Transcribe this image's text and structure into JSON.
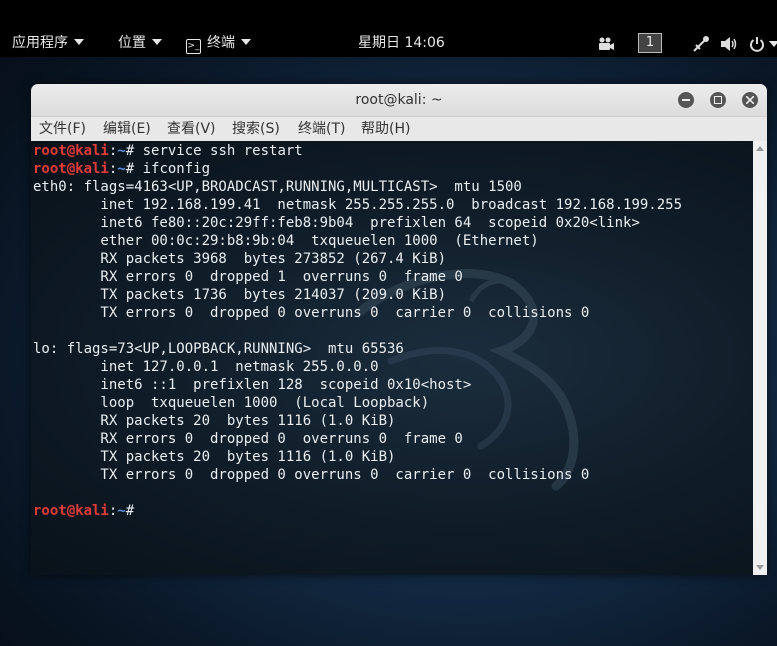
{
  "panel": {
    "applications": "应用程序",
    "places": "位置",
    "terminal": "终端",
    "clock": "星期日 14:06",
    "workspace": "1"
  },
  "window": {
    "title": "root@kali: ~",
    "menu": [
      "文件(F)",
      "编辑(E)",
      "查看(V)",
      "搜索(S)",
      "终端(T)",
      "帮助(H)"
    ]
  },
  "terminal": {
    "prompt_user": "root@kali",
    "prompt_sep": ":",
    "prompt_path": "~",
    "prompt_end": "# ",
    "lines": [
      {
        "type": "prompt",
        "cmd": "service ssh restart"
      },
      {
        "type": "prompt",
        "cmd": "ifconfig"
      },
      {
        "type": "text",
        "text": "eth0: flags=4163<UP,BROADCAST,RUNNING,MULTICAST>  mtu 1500"
      },
      {
        "type": "text",
        "text": "        inet 192.168.199.41  netmask 255.255.255.0  broadcast 192.168.199.255"
      },
      {
        "type": "text",
        "text": "        inet6 fe80::20c:29ff:feb8:9b04  prefixlen 64  scopeid 0x20<link>"
      },
      {
        "type": "text",
        "text": "        ether 00:0c:29:b8:9b:04  txqueuelen 1000  (Ethernet)"
      },
      {
        "type": "text",
        "text": "        RX packets 3968  bytes 273852 (267.4 KiB)"
      },
      {
        "type": "text",
        "text": "        RX errors 0  dropped 1  overruns 0  frame 0"
      },
      {
        "type": "text",
        "text": "        TX packets 1736  bytes 214037 (209.0 KiB)"
      },
      {
        "type": "text",
        "text": "        TX errors 0  dropped 0 overruns 0  carrier 0  collisions 0"
      },
      {
        "type": "text",
        "text": ""
      },
      {
        "type": "text",
        "text": "lo: flags=73<UP,LOOPBACK,RUNNING>  mtu 65536"
      },
      {
        "type": "text",
        "text": "        inet 127.0.0.1  netmask 255.0.0.0"
      },
      {
        "type": "text",
        "text": "        inet6 ::1  prefixlen 128  scopeid 0x10<host>"
      },
      {
        "type": "text",
        "text": "        loop  txqueuelen 1000  (Local Loopback)"
      },
      {
        "type": "text",
        "text": "        RX packets 20  bytes 1116 (1.0 KiB)"
      },
      {
        "type": "text",
        "text": "        RX errors 0  dropped 0  overruns 0  frame 0"
      },
      {
        "type": "text",
        "text": "        TX packets 20  bytes 1116 (1.0 KiB)"
      },
      {
        "type": "text",
        "text": "        TX errors 0  dropped 0 overruns 0  carrier 0  collisions 0"
      },
      {
        "type": "text",
        "text": ""
      },
      {
        "type": "prompt",
        "cmd": ""
      }
    ]
  },
  "colors": {
    "prompt_user": "#e23a3a",
    "prompt_path": "#5b8fe0",
    "terminal_text": "#e9eef2"
  }
}
